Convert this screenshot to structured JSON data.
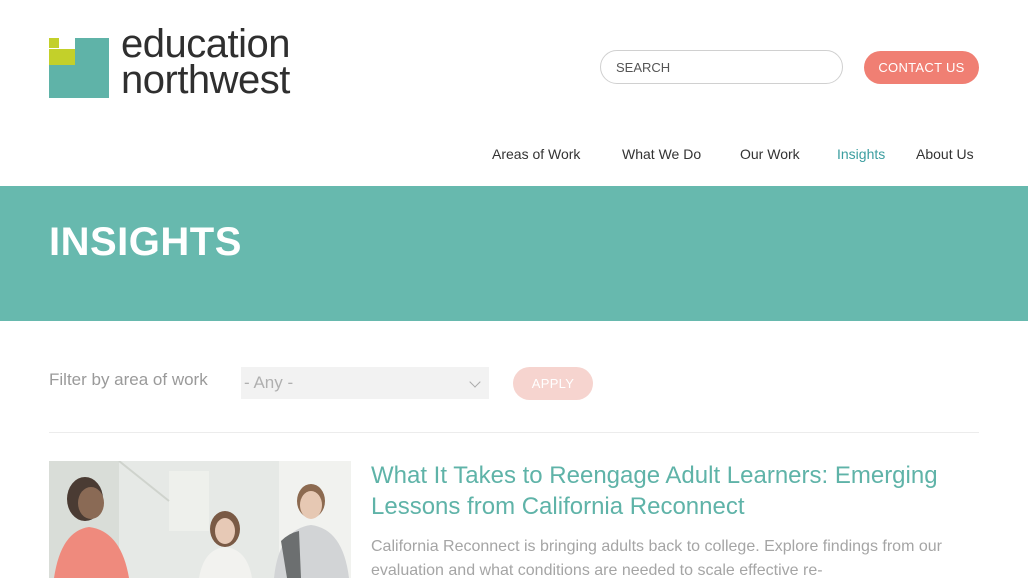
{
  "brand": {
    "logo_line1": "education",
    "logo_line2": "northwest",
    "colors": {
      "teal": "#67b9ae",
      "lime": "#c3d02a",
      "coral": "#f07f73",
      "link": "#3c9ea0"
    }
  },
  "header": {
    "search_placeholder": "SEARCH",
    "contact_label": "CONTACT US"
  },
  "nav": {
    "items": [
      {
        "label": "Areas of Work",
        "active": false
      },
      {
        "label": "What We Do",
        "active": false
      },
      {
        "label": "Our Work",
        "active": false
      },
      {
        "label": "Insights",
        "active": true
      },
      {
        "label": "About Us",
        "active": false
      }
    ]
  },
  "banner": {
    "title": "INSIGHTS"
  },
  "filter": {
    "label": "Filter by area of work",
    "selected": "- Any -",
    "apply_label": "APPLY"
  },
  "articles": [
    {
      "title": "What It Takes to Reengage Adult Learners: Emerging Lessons from California Reconnect",
      "description": "California Reconnect is bringing adults back to college. Explore findings from our evaluation and what conditions are needed to scale effective re-",
      "image": "students-in-hallway-photo"
    }
  ]
}
